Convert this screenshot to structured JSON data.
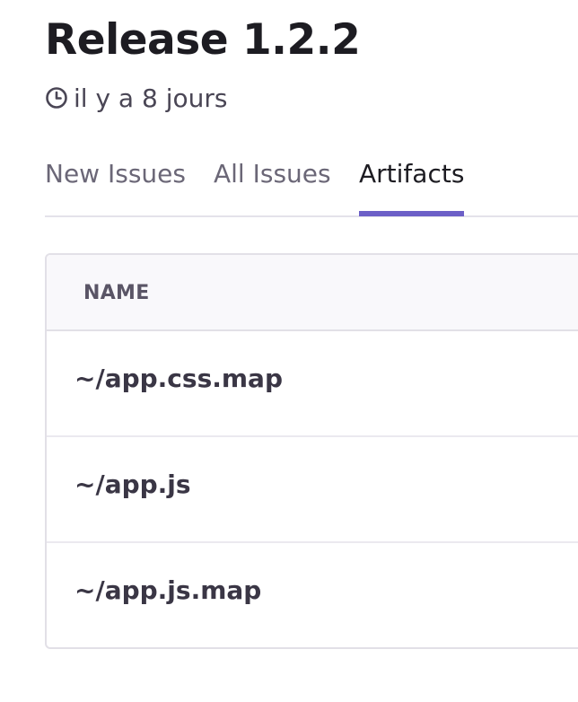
{
  "release": {
    "title": "Release 1.2.2",
    "time_ago": "il y a 8 jours",
    "time_icon": "clock-icon"
  },
  "tabs": [
    {
      "label": "New Issues",
      "active": false
    },
    {
      "label": "All Issues",
      "active": false
    },
    {
      "label": "Artifacts",
      "active": true
    }
  ],
  "artifacts": {
    "columns": [
      "NAME"
    ],
    "rows": [
      {
        "name": "~/app.css.map"
      },
      {
        "name": "~/app.js"
      },
      {
        "name": "~/app.js.map"
      }
    ]
  },
  "colors": {
    "accent": "#6c5fc7",
    "title_text": "#1d1c22",
    "muted_text": "#6b6777",
    "border": "#e2e0e7",
    "header_bg": "#f9f8fb"
  }
}
